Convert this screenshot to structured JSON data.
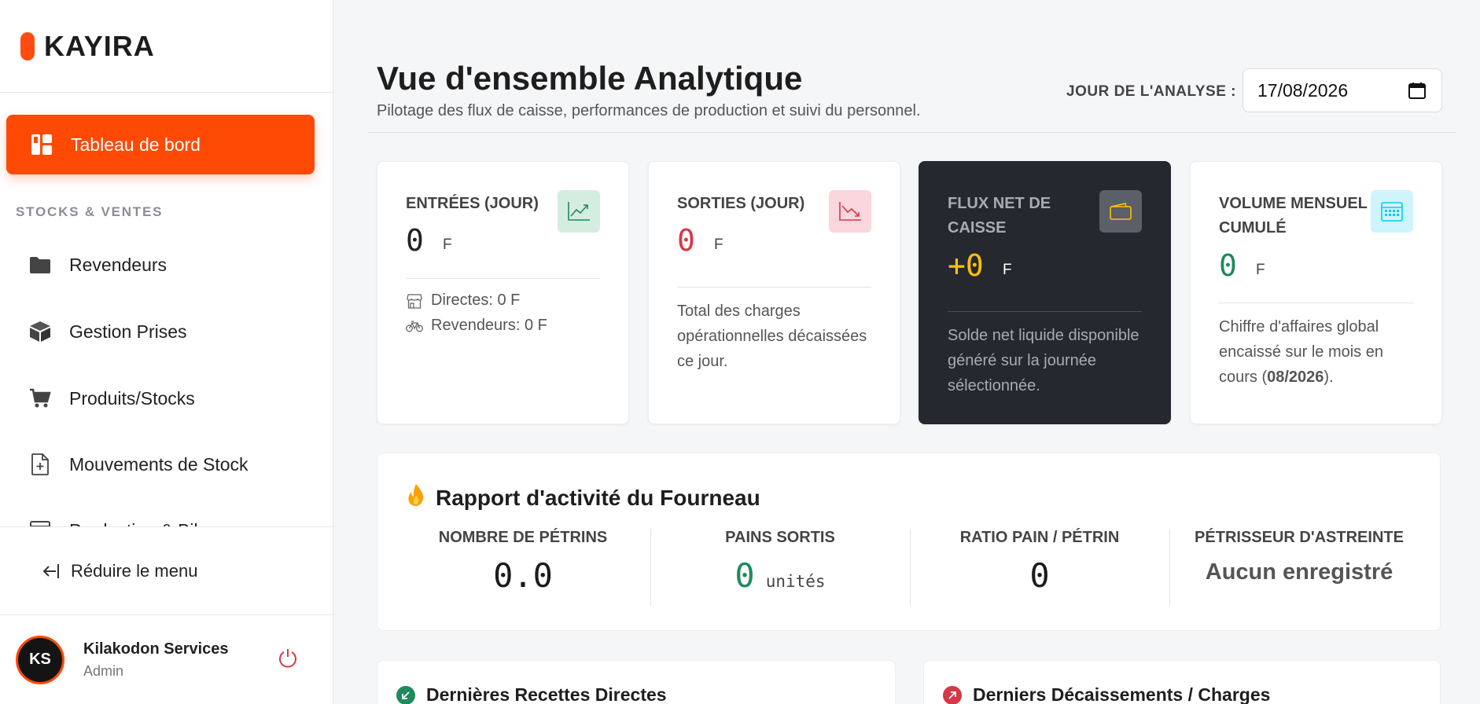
{
  "brand": {
    "name": "KAYIRA",
    "accent": "#ff4a05"
  },
  "sidebar": {
    "active_item": {
      "label": "Tableau de bord",
      "icon": "dashboard-icon"
    },
    "section_label": "STOCKS & VENTES",
    "items": [
      {
        "label": "Revendeurs",
        "icon": "folder-icon"
      },
      {
        "label": "Gestion Prises",
        "icon": "box-icon"
      },
      {
        "label": "Produits/Stocks",
        "icon": "cart-icon"
      },
      {
        "label": "Mouvements de Stock",
        "icon": "file-plus-icon"
      },
      {
        "label": "Production & Bilan",
        "icon": "calendar-icon"
      }
    ],
    "collapse_label": "Réduire le menu",
    "user": {
      "initials": "KS",
      "name": "Kilakodon Services",
      "role": "Admin"
    }
  },
  "header": {
    "title": "Vue d'ensemble Analytique",
    "subtitle": "Pilotage des flux de caisse, performances de production et suivi du personnel.",
    "date_label": "JOUR DE L'ANALYSE :",
    "date_value": "17/08/2026"
  },
  "cards": [
    {
      "title": "ENTRÉES (JOUR)",
      "value": "0",
      "unit": "F",
      "icon": "trend-up-icon",
      "value_color": "#1c1c1c",
      "rows": [
        {
          "icon": "store-icon",
          "text": "Directes: 0 F"
        },
        {
          "icon": "bicycle-icon",
          "text": "Revendeurs: 0 F"
        }
      ]
    },
    {
      "title": "SORTIES (JOUR)",
      "value": "0",
      "unit": "F",
      "icon": "trend-down-icon",
      "value_color": "#dc3545",
      "description": "Total des charges opérationnelles décaissées ce jour."
    },
    {
      "title": "FLUX NET DE CAISSE",
      "value": "+0",
      "unit": "F",
      "icon": "wallet-icon",
      "value_color": "#ffc107",
      "description": "Solde net liquide disponible généré sur la journée sélectionnée."
    },
    {
      "title": "VOLUME MENSUEL CUMULÉ",
      "value": "0",
      "unit": "F",
      "icon": "calendar-grid-icon",
      "value_color": "#1f8a5b",
      "description_pre": "Chiffre d'affaires global encaissé sur le mois en cours (",
      "description_bold": "08/2026",
      "description_post": ")."
    }
  ],
  "report": {
    "title": "Rapport d'activité du Fourneau",
    "icon": "fire-icon",
    "metrics": [
      {
        "label": "NOMBRE DE PÉTRINS",
        "value": "0.0"
      },
      {
        "label": "PAINS SORTIS",
        "value": "0",
        "unit": "unités"
      },
      {
        "label": "RATIO PAIN / PÉTRIN",
        "value": "0"
      },
      {
        "label": "PÉTRISSEUR D'ASTREINTE",
        "text": "Aucun enregistré"
      }
    ]
  },
  "bottom": {
    "left_title": "Dernières Recettes Directes",
    "right_title": "Derniers Décaissements / Charges"
  }
}
